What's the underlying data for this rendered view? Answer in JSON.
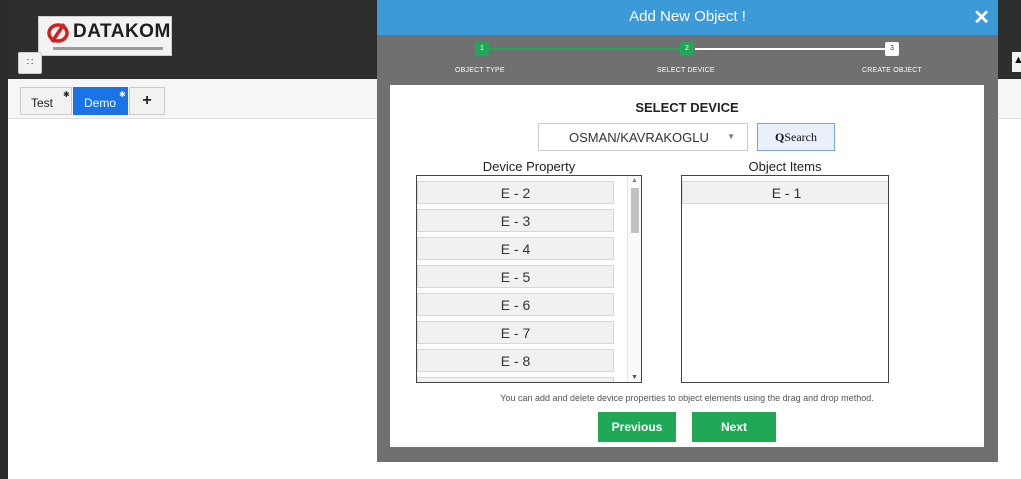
{
  "logo": {
    "text": "DATAKOM"
  },
  "tabs": [
    {
      "label": "Test"
    },
    {
      "label": "Demo"
    },
    {
      "label": "+"
    }
  ],
  "modal": {
    "title": "Add New Object !",
    "close": "✕",
    "steps": [
      {
        "number": "1",
        "label": "OBJECT TYPE",
        "state": "done"
      },
      {
        "number": "2",
        "label": "SELECT DEVICE",
        "state": "active"
      },
      {
        "number": "3",
        "label": "CREATE OBJECT",
        "state": "pending"
      }
    ],
    "section_title": "SELECT DEVICE",
    "device_select": {
      "value": "OSMAN/KAVRAKOGLU"
    },
    "search_label": "Search",
    "device_property": {
      "heading": "Device Property",
      "items": [
        "E - 2",
        "E - 3",
        "E - 4",
        "E - 5",
        "E - 6",
        "E - 7",
        "E - 8"
      ]
    },
    "object_items": {
      "heading": "Object Items",
      "items": [
        "E - 1"
      ]
    },
    "help_text": "You can add and delete device properties to object elements using the drag and drop method.",
    "previous_label": "Previous",
    "next_label": "Next"
  },
  "colors": {
    "header_blue": "#3d9ad9",
    "step_green": "#21a857",
    "tab_active": "#1a73e8",
    "button_green": "#21a857"
  }
}
